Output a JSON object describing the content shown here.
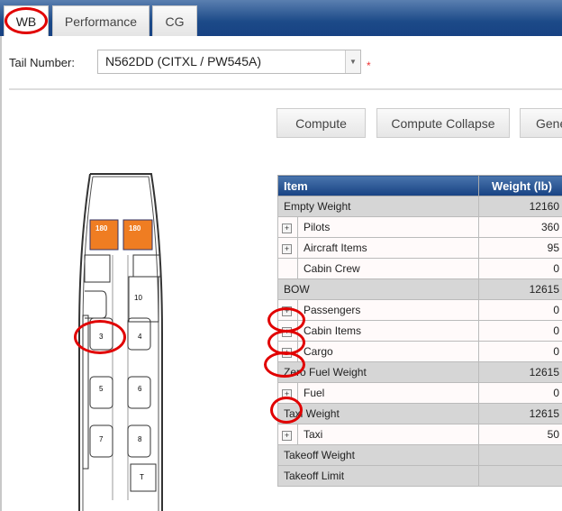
{
  "tabs": [
    {
      "label": "WB"
    },
    {
      "label": "Performance"
    },
    {
      "label": "CG"
    }
  ],
  "form": {
    "tail_label": "Tail Number:",
    "tail_value": "N562DD (CITXL / PW545A)",
    "required": "*"
  },
  "buttons": {
    "compute": "Compute",
    "compute_collapse": "Compute Collapse",
    "generate": "Gene"
  },
  "seatmap": {
    "pilot_weights": [
      "180",
      "180"
    ],
    "seats": [
      "10",
      "3",
      "4",
      "5",
      "6",
      "7",
      "8",
      "T"
    ],
    "pilot_color": "#ef7d22"
  },
  "table": {
    "headers": [
      "Item",
      "Weight (lb)"
    ],
    "rows": [
      {
        "type": "sum",
        "item": "Empty Weight",
        "weight": "12160"
      },
      {
        "type": "sub",
        "expand": true,
        "item": "Pilots",
        "weight": "360"
      },
      {
        "type": "sub",
        "expand": true,
        "item": "Aircraft Items",
        "weight": "95"
      },
      {
        "type": "sub",
        "expand": false,
        "item": "Cabin Crew",
        "weight": "0"
      },
      {
        "type": "sum",
        "item": "BOW",
        "weight": "12615"
      },
      {
        "type": "sub",
        "expand": true,
        "item": "Passengers",
        "weight": "0"
      },
      {
        "type": "sub",
        "expand": true,
        "item": "Cabin Items",
        "weight": "0"
      },
      {
        "type": "sub",
        "expand": true,
        "item": "Cargo",
        "weight": "0"
      },
      {
        "type": "sum",
        "item": "Zero Fuel Weight",
        "weight": "12615"
      },
      {
        "type": "sub",
        "expand": true,
        "item": "Fuel",
        "weight": "0"
      },
      {
        "type": "sum",
        "item": "Taxi Weight",
        "weight": "12615"
      },
      {
        "type": "sub",
        "expand": true,
        "item": "Taxi",
        "weight": "50"
      },
      {
        "type": "sum",
        "item": "Takeoff Weight",
        "weight": ""
      },
      {
        "type": "sum",
        "item": "Takeoff Limit",
        "weight": ""
      }
    ]
  },
  "colors": {
    "header": "#174283",
    "annotation": "#e10000"
  }
}
